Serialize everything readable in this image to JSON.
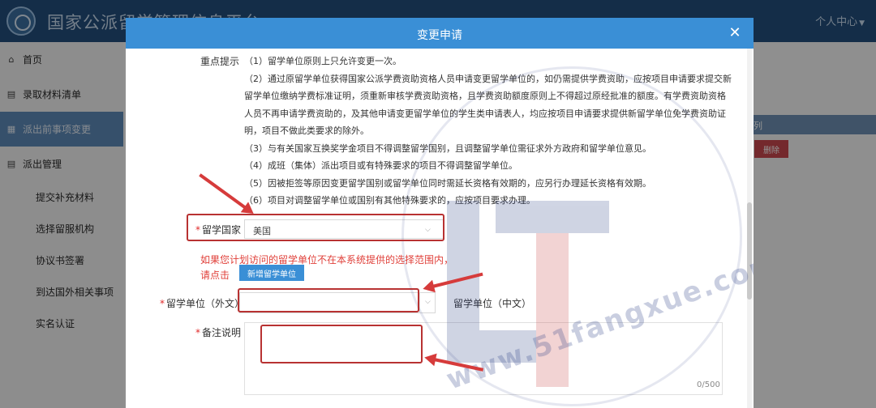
{
  "app": {
    "title": "国家公派留学管理信息平台",
    "user_center": "个人中心"
  },
  "sidebar": {
    "items": [
      {
        "label": "首页",
        "icon": "home-icon",
        "active": false
      },
      {
        "label": "录取材料清单",
        "icon": "document-icon",
        "active": false
      },
      {
        "label": "派出前事项变更",
        "icon": "edit-icon",
        "active": true
      },
      {
        "label": "派出管理",
        "icon": "document-icon",
        "active": false
      }
    ],
    "sub_items": [
      "提交补充材料",
      "选择留服机构",
      "协议书签署",
      "到达国外相关事项",
      "实名认证"
    ]
  },
  "background": {
    "table_header": "列",
    "delete_label": "删除"
  },
  "modal": {
    "title": "变更申请",
    "close_icon": "close-icon",
    "notice_label": "重点提示",
    "notice_lines": [
      "（1）留学单位原则上只允许变更一次。",
      "（2）通过原留学单位获得国家公派学费资助资格人员申请变更留学单位的，如仍需提供学费资助，应按项目申请要求提交新",
      "留学单位缴纳学费标准证明，须重新审核学费资助资格，且学费资助额度原则上不得超过原经批准的额度。有学费资助资格",
      "人员不再申请学费资助的，及其他申请变更留学单位的学生类申请表人，均应按项目申请要求提供新留学单位免学费资助证",
      "明，项目不做此类要求的除外。",
      "（3）与有关国家互换奖学金项目不得调整留学国别，且调整留学单位需征求外方政府和留学单位意见。",
      "（4）成班（集体）派出项目或有特殊要求的项目不得调整留学单位。",
      "（5）因被拒签等原因变更留学国别或留学单位同时需延长资格有效期的，应另行办理延长资格有效期。",
      "（6）项目对调整留学单位或国别有其他特殊要求的，应按项目要求办理。"
    ],
    "country_label": "留学国家",
    "country_value": "美国",
    "hint_line1": "如果您计划访问的留学单位不在本系统提供的选择范围内，",
    "hint_line2": "请点击",
    "add_unit_button": "新增留学单位",
    "unit_foreign_label": "留学单位（外文）",
    "unit_foreign_value": "",
    "unit_chinese_label": "留学单位（中文）",
    "note_label": "备注说明",
    "note_value": "",
    "note_counter": "0/500"
  },
  "watermark": {
    "text": "www.51fangxue.com"
  },
  "colors": {
    "topbar": "#234e7d",
    "modal_header": "#3a8fd6",
    "sidebar_active": "#5e8ab8",
    "required": "#e02a2a",
    "annotation": "#b83232"
  }
}
